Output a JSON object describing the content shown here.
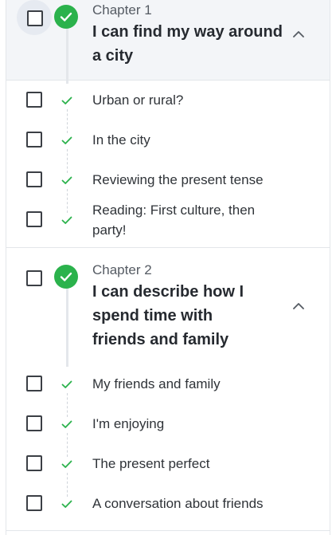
{
  "chapters": [
    {
      "label": "Chapter 1",
      "title": "I can find my way around a city",
      "lessons": [
        {
          "title": "Urban or rural?"
        },
        {
          "title": "In the city"
        },
        {
          "title": "Reviewing the present tense"
        },
        {
          "title": "Reading: First culture, then party!"
        }
      ]
    },
    {
      "label": "Chapter 2",
      "title": "I can describe how I spend time with friends and family",
      "lessons": [
        {
          "title": "My friends and family"
        },
        {
          "title": "I'm enjoying"
        },
        {
          "title": "The present perfect"
        },
        {
          "title": "A conversation about friends"
        }
      ]
    }
  ],
  "colors": {
    "complete_green": "#2bb24c",
    "header_bg": "#f3f5f8",
    "border": "#e3e6ea"
  },
  "icons": {
    "complete": "check-icon",
    "collapse": "chevron-up-icon"
  }
}
